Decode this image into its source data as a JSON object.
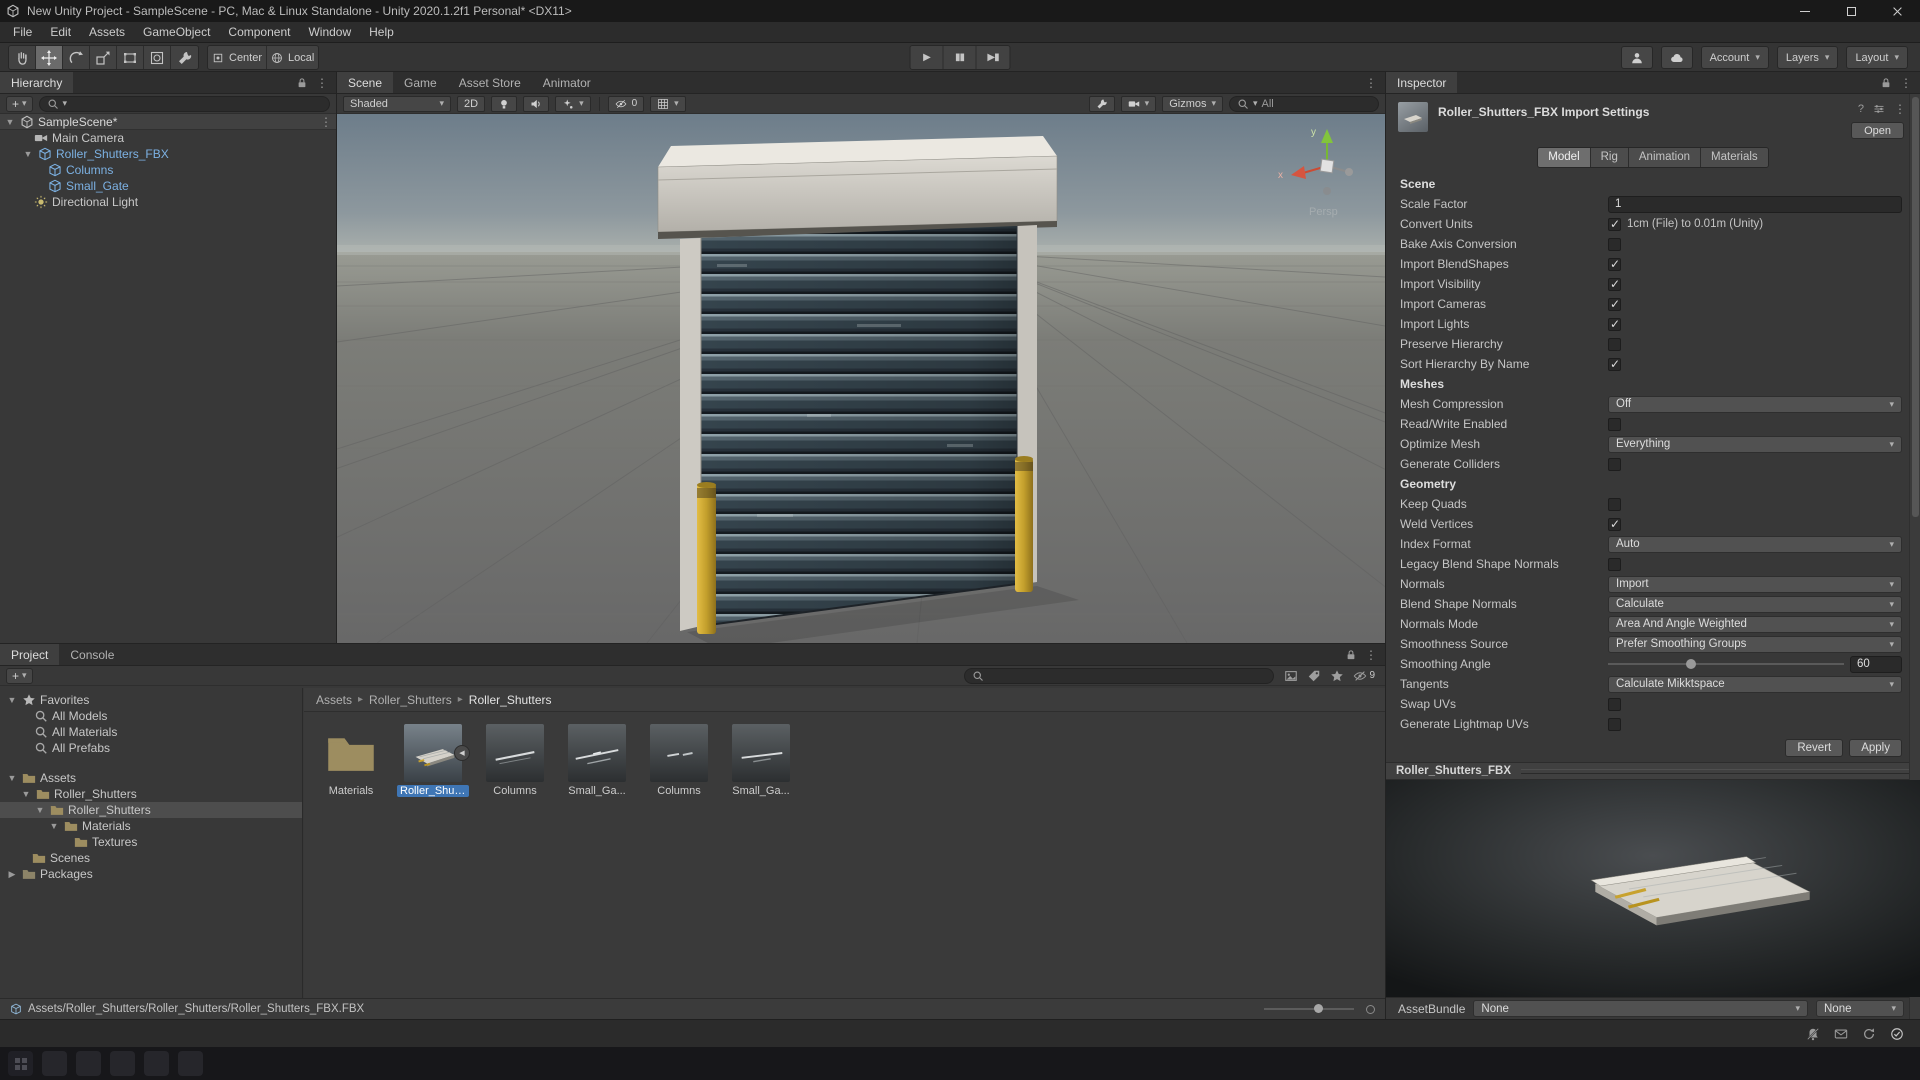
{
  "window": {
    "title": "New Unity Project - SampleScene - PC, Mac & Linux Standalone - Unity 2020.1.2f1 Personal* <DX11>"
  },
  "menu": {
    "items": [
      "File",
      "Edit",
      "Assets",
      "GameObject",
      "Component",
      "Window",
      "Help"
    ]
  },
  "toolbar": {
    "pivot": "Center",
    "space": "Local",
    "account": "Account",
    "layers": "Layers",
    "layout": "Layout"
  },
  "icons": {
    "caret": "▾",
    "foldout_open": "▼",
    "foldout_closed": "▶",
    "kebab": "⋮",
    "crumb_sep": "▸",
    "play": "▶",
    "pause": "▮▮",
    "step": "▶▮",
    "subasset": "◀",
    "plus": "+",
    "help": "?"
  },
  "hierarchy": {
    "title": "Hierarchy",
    "scene_name": "SampleScene*",
    "items": [
      {
        "label": "Main Camera"
      },
      {
        "label": "Roller_Shutters_FBX"
      },
      {
        "label": "Columns"
      },
      {
        "label": "Small_Gate"
      },
      {
        "label": "Directional Light"
      }
    ]
  },
  "scene": {
    "tabs": [
      "Scene",
      "Game",
      "Asset Store",
      "Animator"
    ],
    "shading": "Shaded",
    "mode_2d": "2D",
    "hidden_count": "0",
    "gizmos": "Gizmos",
    "search_filter": "All",
    "axis_x": "x",
    "axis_y": "y",
    "projection": "Persp"
  },
  "inspector": {
    "panel_title": "Inspector",
    "title": "Roller_Shutters_FBX Import Settings",
    "open": "Open",
    "tabs": [
      "Model",
      "Rig",
      "Animation",
      "Materials"
    ],
    "sections": [
      "Scene",
      "Meshes",
      "Geometry"
    ],
    "rows": [
      {
        "label": "Scale Factor",
        "value": "1"
      },
      {
        "label": "Convert Units",
        "value": true,
        "note": "1cm (File) to 0.01m (Unity)"
      },
      {
        "label": "Bake Axis Conversion",
        "value": false
      },
      {
        "label": "Import BlendShapes",
        "value": true
      },
      {
        "label": "Import Visibility",
        "value": true
      },
      {
        "label": "Import Cameras",
        "value": true
      },
      {
        "label": "Import Lights",
        "value": true
      },
      {
        "label": "Preserve Hierarchy",
        "value": false
      },
      {
        "label": "Sort Hierarchy By Name",
        "value": true
      },
      {
        "label": "Mesh Compression",
        "value": "Off"
      },
      {
        "label": "Read/Write Enabled",
        "value": false
      },
      {
        "label": "Optimize Mesh",
        "value": "Everything"
      },
      {
        "label": "Generate Colliders",
        "value": false
      },
      {
        "label": "Keep Quads",
        "value": false
      },
      {
        "label": "Weld Vertices",
        "value": true
      },
      {
        "label": "Index Format",
        "value": "Auto"
      },
      {
        "label": "Legacy Blend Shape Normals",
        "value": false
      },
      {
        "label": "Normals",
        "value": "Import"
      },
      {
        "label": "Blend Shape Normals",
        "value": "Calculate"
      },
      {
        "label": "Normals Mode",
        "value": "Area And Angle Weighted"
      },
      {
        "label": "Smoothness Source",
        "value": "Prefer Smoothing Groups"
      },
      {
        "label": "Smoothing Angle",
        "value": "60"
      },
      {
        "label": "Tangents",
        "value": "Calculate Mikktspace"
      },
      {
        "label": "Swap UVs",
        "value": false
      },
      {
        "label": "Generate Lightmap UVs",
        "value": false
      }
    ],
    "revert": "Revert",
    "apply": "Apply",
    "preview_title": "Roller_Shutters_FBX",
    "assetbundle_label": "AssetBundle",
    "assetbundle_value": "None",
    "assetbundle_variant": "None"
  },
  "project": {
    "tabs": [
      "Project",
      "Console"
    ],
    "favorites_label": "Favorites",
    "favorites": [
      "All Models",
      "All Materials",
      "All Prefabs"
    ],
    "tree": [
      {
        "label": "Assets"
      },
      {
        "label": "Roller_Shutters"
      },
      {
        "label": "Roller_Shutters"
      },
      {
        "label": "Materials"
      },
      {
        "label": "Textures"
      },
      {
        "label": "Scenes"
      },
      {
        "label": "Packages"
      }
    ],
    "breadcrumb": [
      "Assets",
      "Roller_Shutters",
      "Roller_Shutters"
    ],
    "items": [
      {
        "label": "Materials"
      },
      {
        "label": "Roller_Shut..."
      },
      {
        "label": "Columns"
      },
      {
        "label": "Small_Ga..."
      },
      {
        "label": "Columns"
      },
      {
        "label": "Small_Ga..."
      }
    ],
    "path": "Assets/Roller_Shutters/Roller_Shutters/Roller_Shutters_FBX.FBX",
    "hidden_badge": "9"
  }
}
